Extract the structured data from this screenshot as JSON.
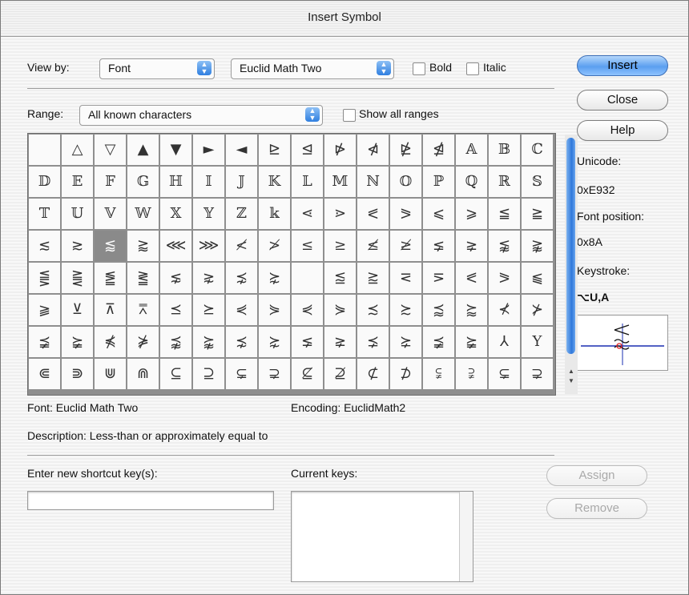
{
  "window": {
    "title": "Insert Symbol"
  },
  "view_by": {
    "label": "View by:",
    "mode": "Font",
    "font": "Euclid Math Two"
  },
  "bold": {
    "label": "Bold",
    "checked": false
  },
  "italic": {
    "label": "Italic",
    "checked": false
  },
  "buttons": {
    "insert": "Insert",
    "close": "Close",
    "help": "Help",
    "assign": "Assign",
    "remove": "Remove"
  },
  "range": {
    "label": "Range:",
    "value": "All known characters",
    "show_all_label": "Show all ranges",
    "show_all_checked": false
  },
  "info": {
    "unicode_label": "Unicode:",
    "unicode": "0xE932",
    "font_position_label": "Font position:",
    "font_position": "0x8A",
    "keystroke_label": "Keystroke:",
    "keystroke": "⌥U,A"
  },
  "preview_icon": "less-than-or-approx-equal-icon",
  "selected_symbol": "⪅",
  "symbols": [
    [
      "",
      "△",
      "▽",
      "▲",
      "▼",
      "►",
      "◄",
      "⊵",
      "⊴",
      "⋫",
      "⋪",
      "⋭",
      "⋬",
      "𝔸",
      "𝔹",
      "ℂ"
    ],
    [
      "𝔻",
      "𝔼",
      "𝔽",
      "𝔾",
      "ℍ",
      "𝕀",
      "𝕁",
      "𝕂",
      "𝕃",
      "𝕄",
      "ℕ",
      "𝕆",
      "ℙ",
      "ℚ",
      "ℝ",
      "𝕊"
    ],
    [
      "𝕋",
      "𝕌",
      "𝕍",
      "𝕎",
      "𝕏",
      "𝕐",
      "ℤ",
      "𝕜",
      "⋖",
      "⋗",
      "⪕",
      "⪖",
      "⩽",
      "⩾",
      "≦",
      "≧"
    ],
    [
      "≲",
      "≳",
      "⪅",
      "⪆",
      "⋘",
      "⋙",
      "≮",
      "≯",
      "≤",
      "≥",
      "≰",
      "≱",
      "⪇",
      "⪈",
      "⪉",
      "⪊"
    ],
    [
      "⪋",
      "⪌",
      "⪑",
      "⪒",
      "⋦",
      "⋧",
      "⋨",
      "⋩",
      "",
      "⪍",
      "⪎",
      "⋜",
      "⋝",
      "⪕",
      "⪖",
      "⫹"
    ],
    [
      "⫺",
      "⊻",
      "⊼",
      "⩞",
      "⪯",
      "⪰",
      "⋞",
      "⋟",
      "⋞",
      "⋟",
      "≾",
      "≿",
      "⪷",
      "⪸",
      "⊀",
      "⊁"
    ],
    [
      "⪵",
      "⪶",
      "⋠",
      "⋡",
      "⪹",
      "⪺",
      "⋨",
      "⋩",
      "⪇",
      "⪈",
      "⪱",
      "⪲",
      "⪵",
      "⪶",
      "⅄",
      "Υ"
    ],
    [
      "⋐",
      "⋑",
      "⋓",
      "⋒",
      "⊆",
      "⊇",
      "⊊",
      "⊋",
      "⊈",
      "⊉",
      "⊄",
      "⊅",
      "⫋",
      "⫌",
      "⊊",
      "⊋"
    ]
  ],
  "font_line": "Font: Euclid Math Two",
  "encoding_line": "Encoding:  EuclidMath2",
  "description_line": "Description:   Less-than or approximately equal to",
  "shortcut": {
    "new_label": "Enter new shortcut key(s):",
    "new_value": "",
    "current_label": "Current keys:"
  }
}
